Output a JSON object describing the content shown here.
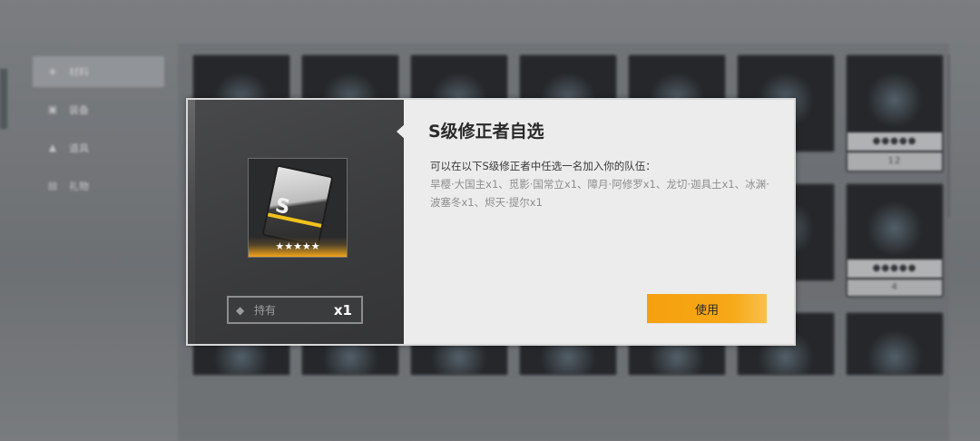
{
  "sidebar": {
    "items": [
      {
        "label": "材料",
        "icon": "materials-icon"
      },
      {
        "label": "装备",
        "icon": "equipment-icon"
      },
      {
        "label": "道具",
        "icon": "props-icon"
      },
      {
        "label": "礼物",
        "icon": "gift-icon"
      }
    ]
  },
  "inventory": {
    "row2_counts": [
      "12",
      "4"
    ]
  },
  "dialog": {
    "title": "S级修正者自选",
    "description_lead": "可以在以下S级修正者中任选一名加入你的队伍：",
    "description_names": "旱樱·大国主x1、觅影·国常立x1、障月·阿修罗x1、龙切·迦具土x1、冰渊·波塞冬x1、烬天·提尔x1",
    "item_rarity": "★★★★★",
    "owned_label": "持有",
    "owned_quantity": "x1",
    "use_button": "使用"
  },
  "colors": {
    "accent": "#f5a00f",
    "dialog_bg": "#ececec",
    "left_panel": "#3a3b3d"
  }
}
